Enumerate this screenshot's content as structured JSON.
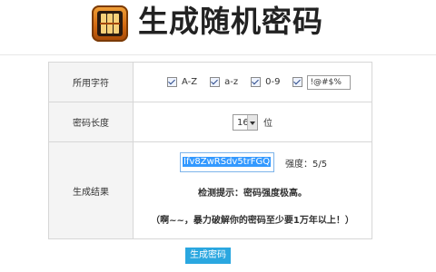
{
  "header": {
    "title": "生成随机密码",
    "logo_icon": "slot-machine-icon"
  },
  "form": {
    "charset": {
      "label": "所用字符",
      "options": [
        {
          "label": "A-Z",
          "checked": true
        },
        {
          "label": "a-z",
          "checked": true
        },
        {
          "label": "0-9",
          "checked": true
        }
      ],
      "symbols": {
        "checked": true,
        "value": "!@#$%"
      }
    },
    "length": {
      "label": "密码长度",
      "value": "16",
      "unit": "位"
    },
    "result": {
      "label": "生成结果",
      "password": "Ifv8ZwRSdv5trFGQ",
      "strength": "强度：5/5",
      "hint": "检测提示：密码强度极高。",
      "note": "（啊~~，暴力破解你的密码至少要1万年以上！）"
    }
  },
  "actions": {
    "generate_label": "生成密码"
  },
  "colors": {
    "button": "#2aa7e0",
    "selection": "#3399ff"
  }
}
